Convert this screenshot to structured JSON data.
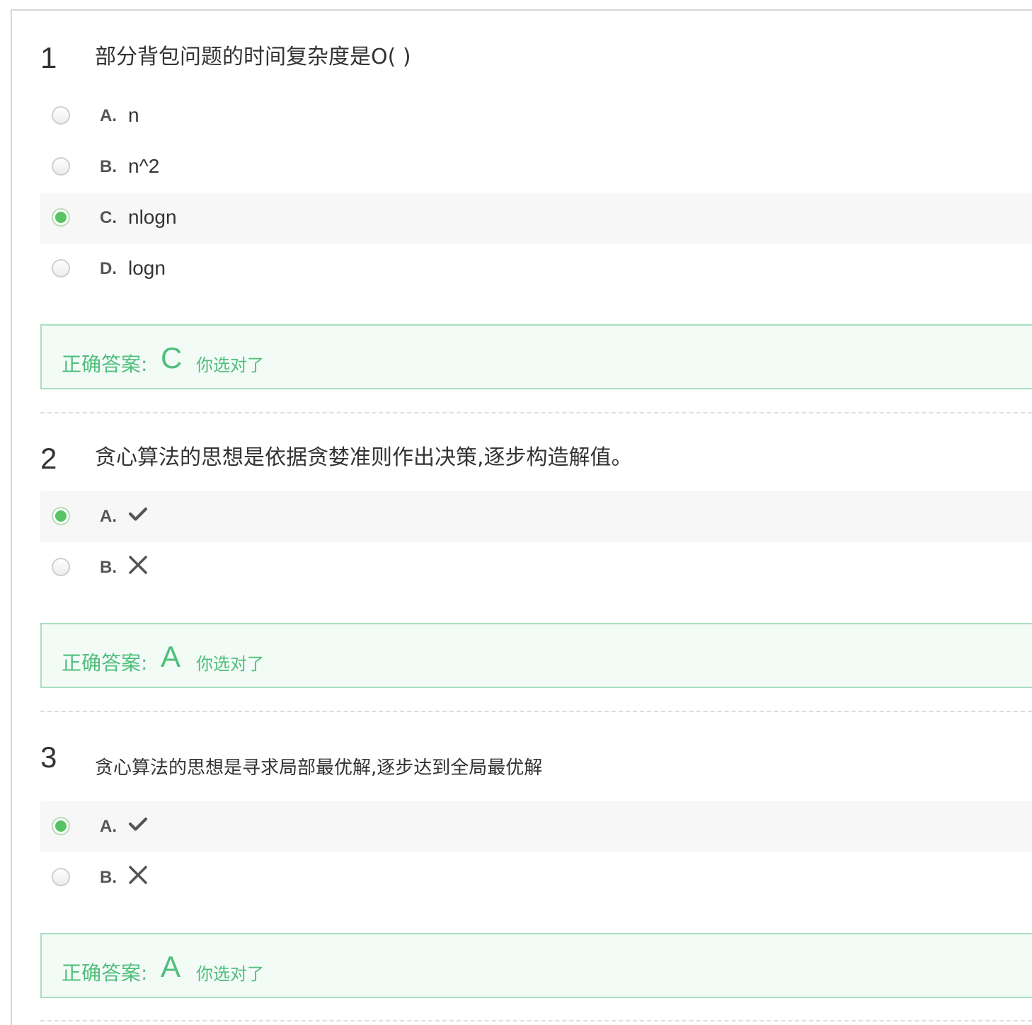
{
  "questions": [
    {
      "number": "1",
      "title": "部分背包问题的时间复杂度是O( )",
      "options": [
        {
          "letter": "A.",
          "text": "n",
          "selected": false
        },
        {
          "letter": "B.",
          "text": "n^2",
          "selected": false
        },
        {
          "letter": "C.",
          "text": "nlogn",
          "selected": true
        },
        {
          "letter": "D.",
          "text": "logn",
          "selected": false
        }
      ],
      "answer": {
        "label": "正确答案:",
        "letter": "C",
        "note": "你选对了"
      }
    },
    {
      "number": "2",
      "title": "贪心算法的思想是依据贪婪准则作出决策,逐步构造解值。",
      "options": [
        {
          "letter": "A.",
          "icon": "check-icon",
          "selected": true
        },
        {
          "letter": "B.",
          "icon": "cross-icon",
          "selected": false
        }
      ],
      "answer": {
        "label": "正确答案:",
        "letter": "A",
        "note": "你选对了"
      }
    },
    {
      "number": "3",
      "title": "贪心算法的思想是寻求局部最优解,逐步达到全局最优解",
      "options": [
        {
          "letter": "A.",
          "icon": "check-icon",
          "selected": true
        },
        {
          "letter": "B.",
          "icon": "cross-icon",
          "selected": false
        }
      ],
      "answer": {
        "label": "正确答案:",
        "letter": "A",
        "note": "你选对了"
      }
    }
  ],
  "colors": {
    "accent_green": "#4fbf7a",
    "radio_selected": "#57c463",
    "answer_bg": "#f3fbf7",
    "answer_border": "#a8dfbf",
    "selected_row_bg": "#f7f7f7"
  }
}
